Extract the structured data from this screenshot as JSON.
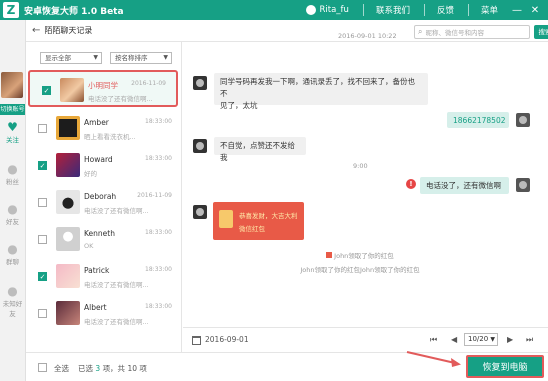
{
  "app": {
    "title": "安卓恢复大师 1.0 Beta",
    "logo_glyph": "Z"
  },
  "titlebar": {
    "user": "Rita_fu",
    "contact": "联系我们",
    "feedback": "反馈",
    "menu": "菜单",
    "minimize": "—",
    "close": "✕"
  },
  "sidebar": {
    "tag": "切换账号",
    "nav": [
      {
        "label": "关注",
        "icon": "heart-icon"
      },
      {
        "label": "粉丝",
        "icon": "person-icon"
      },
      {
        "label": "好友",
        "icon": "person-icon"
      },
      {
        "label": "群聊",
        "icon": "group-icon"
      },
      {
        "label": "未知好友",
        "icon": "person-unknown-icon"
      }
    ]
  },
  "header": {
    "back": "←",
    "breadcrumb": "陌陌聊天记录",
    "search_placeholder": "昵称、微信号和内容",
    "search_button": "搜索"
  },
  "list": {
    "filter_show": "显示全部",
    "filter_sort": "按名称排序",
    "items": [
      {
        "name": "小明同学",
        "time": "2016-11-09",
        "msg": "电话没了还有微信啊...",
        "checked": true
      },
      {
        "name": "Amber",
        "time": "18:33:00",
        "msg": "晒上看看洗衣机...",
        "checked": false
      },
      {
        "name": "Howard",
        "time": "18:33:00",
        "msg": "好的",
        "checked": true
      },
      {
        "name": "Deborah",
        "time": "2016-11-09",
        "msg": "电话没了还有微信啊...",
        "checked": false
      },
      {
        "name": "Kenneth",
        "time": "18:33:00",
        "msg": "OK",
        "checked": false
      },
      {
        "name": "Patrick",
        "time": "18:33:00",
        "msg": "电话没了还有微信啊...",
        "checked": true
      },
      {
        "name": "Albert",
        "time": "18:33:00",
        "msg": "电话没了还有微信啊...",
        "checked": false
      }
    ]
  },
  "chat": {
    "date1": "2016-09-01 10:22",
    "msg1_line1": "同学号码再发我一下啊，通讯录丢了，找不回来了，备份也不",
    "msg1_line2": "见了，太坑",
    "msg2": "18662178502",
    "msg3": "不自觉，点赞还不发给我",
    "time2": "9:00",
    "msg4": "电话没了，还有微信啊",
    "redpacket_line1": "恭喜发财，大吉大利",
    "redpacket_line2": "微信红包",
    "sys1": "John领取了你的红包",
    "sys2": "John领取了你的红包John领取了你的红包"
  },
  "pager": {
    "date": "2016-09-01",
    "page": "10/20",
    "first": "⏮",
    "prev": "◀",
    "next": "▶",
    "last": "⏭"
  },
  "footer": {
    "select_all": "全选",
    "selected_prefix": "已选",
    "selected_count": "3",
    "total_text": "项，共 10 项",
    "restore": "恢复到电脑"
  },
  "colors": {
    "accent": "#16a085",
    "highlight": "#e25b5b"
  }
}
